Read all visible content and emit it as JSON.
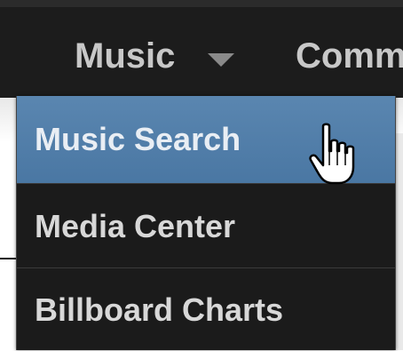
{
  "nav": {
    "music_label": "Music",
    "next_label": "Comm",
    "caret_icon": "caret-down-icon"
  },
  "dropdown": {
    "items": [
      {
        "label": "Music Search",
        "state": "hover"
      },
      {
        "label": "Media Center"
      },
      {
        "label": "Billboard Charts"
      }
    ]
  },
  "colors": {
    "nav_bg": "#1c1c1c",
    "menu_bg": "#1b1b1b",
    "hover_bg": "#4f7ca8",
    "text": "#d8d8d8"
  },
  "cursor_icon": "hand-pointer-icon"
}
